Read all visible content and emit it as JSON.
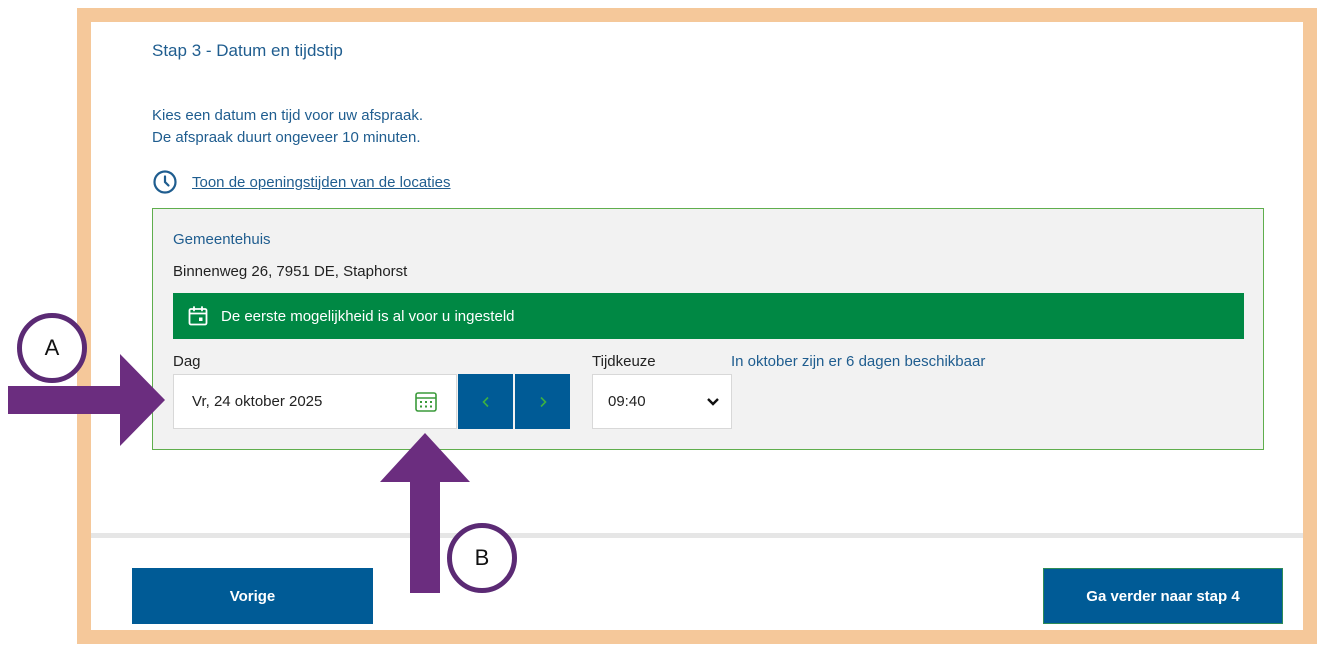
{
  "step_title": "Stap 3 - Datum en tijdstip",
  "intro": {
    "line1": "Kies een datum en tijd voor uw afspraak.",
    "line2": "De afspraak duurt ongeveer 10 minuten."
  },
  "hours_link": {
    "icon": "clock-icon",
    "label": "Toon de openingstijden van de locaties"
  },
  "location": {
    "name": "Gemeentehuis",
    "address": "Binnenweg 26, 7951 DE, Staphorst",
    "banner_icon": "calendar-icon",
    "banner_text": "De eerste mogelijkheid is al voor u ingesteld",
    "day_label": "Dag",
    "date_value": "Vr, 24 oktober 2025",
    "calendar_icon": "calendar-grid-icon",
    "prev_icon": "chevron-left-icon",
    "next_icon": "chevron-right-icon",
    "time_label": "Tijdkeuze",
    "time_value": "09:40",
    "availability": "In oktober zijn er 6 dagen beschikbaar"
  },
  "footer": {
    "prev_label": "Vorige",
    "next_label": "Ga verder naar stap 4"
  },
  "annotations": {
    "a_label": "A",
    "b_label": "B"
  },
  "colors": {
    "frame": "#f5c89a",
    "primary": "#005b96",
    "success": "#008844",
    "card_border": "#5fae4d",
    "annotation": "#6b2d7f",
    "link": "#1f5d8f"
  }
}
